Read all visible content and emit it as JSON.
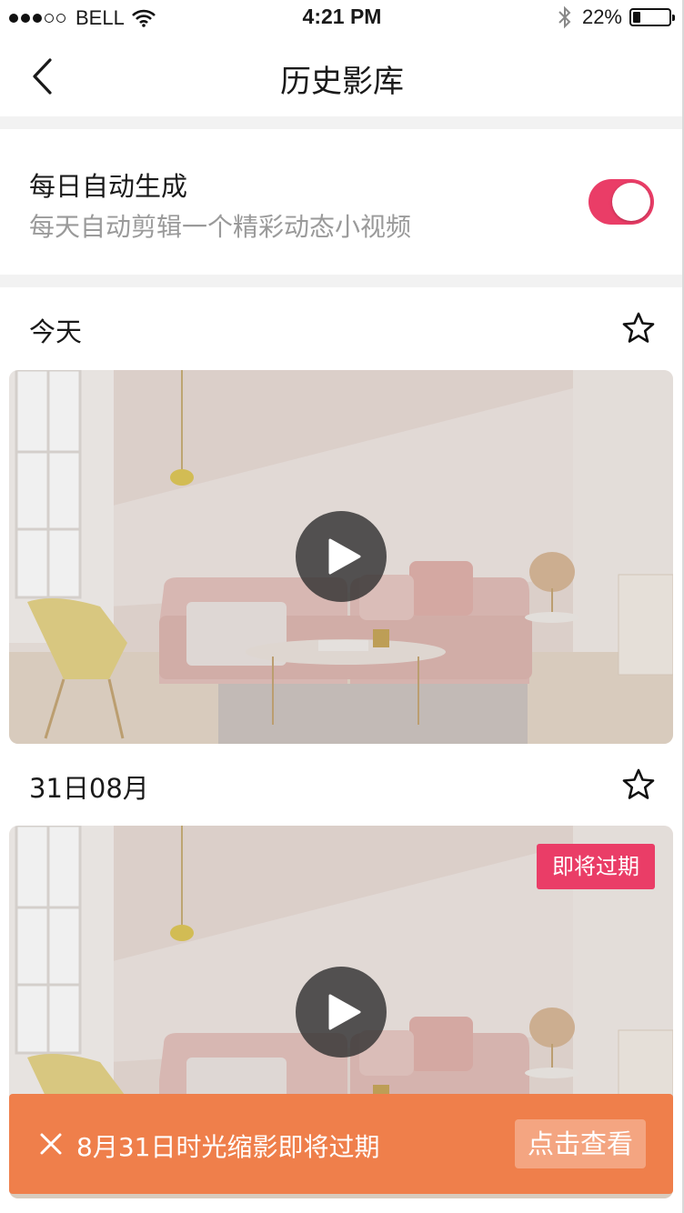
{
  "status_bar": {
    "carrier": "BELL",
    "time": "4:21 PM",
    "battery": "22%",
    "battery_level": 0.22,
    "signal_dots_filled": 3,
    "signal_dots_total": 5,
    "icons": [
      "wifi-icon",
      "bluetooth-icon",
      "battery-icon"
    ]
  },
  "nav": {
    "title": "历史影库",
    "back_icon": "chevron-left-icon"
  },
  "auto_generate": {
    "title": "每日自动生成",
    "description": "每天自动剪辑一个精彩动态小视频",
    "enabled": true
  },
  "sections": [
    {
      "date_label": "今天",
      "star_icon": "star-outline-icon",
      "badge": ""
    },
    {
      "date_label": "31日08月",
      "star_icon": "star-outline-icon",
      "badge": "即将过期"
    }
  ],
  "toast": {
    "message": "8月31日时光缩影即将过期",
    "action": "点击查看",
    "close_icon": "close-icon"
  },
  "colors": {
    "accent": "#ea3d67",
    "toast_bg": "#ef7f4b",
    "divider": "#f2f2f2"
  }
}
